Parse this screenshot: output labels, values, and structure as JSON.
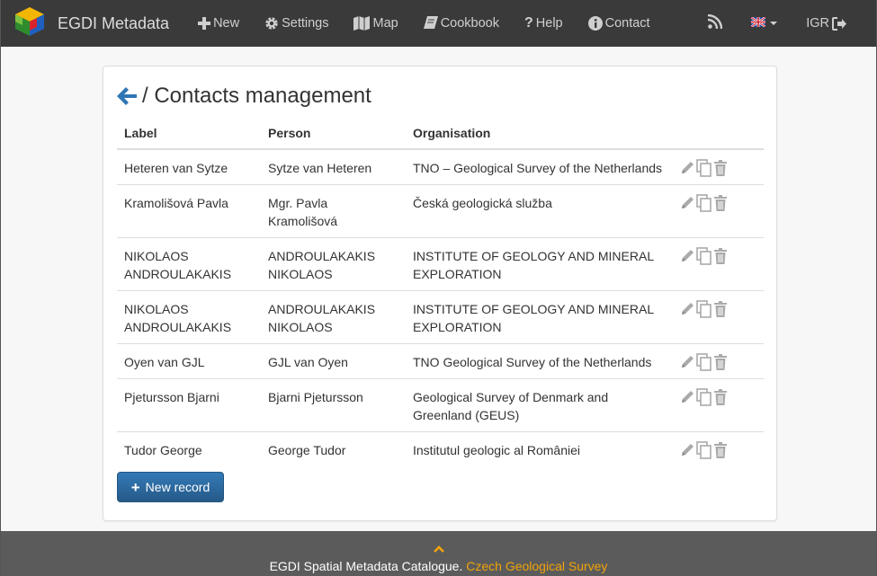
{
  "navbar": {
    "brand": "EGDI Metadata",
    "items": [
      {
        "label": "New",
        "icon": "plus-icon"
      },
      {
        "label": "Settings",
        "icon": "gear-icon"
      },
      {
        "label": "Map",
        "icon": "map-icon"
      },
      {
        "label": "Cookbook",
        "icon": "book-icon"
      },
      {
        "label": "Help",
        "icon": "question-icon"
      },
      {
        "label": "Contact",
        "icon": "info-icon"
      }
    ],
    "rss_icon": "rss-icon",
    "language_icon": "uk-flag-icon",
    "user": "IGR",
    "logout_icon": "logout-icon"
  },
  "page": {
    "title": "/ Contacts management",
    "back_icon": "arrow-left-icon"
  },
  "table": {
    "headers": [
      "Label",
      "Person",
      "Organisation"
    ],
    "rows": [
      {
        "label": "Heteren van Sytze",
        "person": "Sytze van Heteren",
        "organisation": "TNO – Geological Survey of the Netherlands"
      },
      {
        "label": "Kramolišová Pavla",
        "person": "Mgr. Pavla Kramolišová",
        "organisation": "Česká geologická služba"
      },
      {
        "label": "NIKOLAOS ANDROULAKAKIS",
        "person": "ANDROULAKAKIS NIKOLAOS",
        "organisation": "INSTITUTE OF GEOLOGY AND MINERAL EXPLORATION"
      },
      {
        "label": "NIKOLAOS ANDROULAKAKIS",
        "person": "ANDROULAKAKIS NIKOLAOS",
        "organisation": "INSTITUTE OF GEOLOGY AND MINERAL EXPLORATION"
      },
      {
        "label": "Oyen van GJL",
        "person": "GJL van Oyen",
        "organisation": "TNO Geological Survey of the Netherlands"
      },
      {
        "label": "Pjetursson Bjarni",
        "person": "Bjarni Pjetursson",
        "organisation": "Geological Survey of Denmark and Greenland (GEUS)"
      },
      {
        "label": "Tudor George",
        "person": "George Tudor",
        "organisation": "Institutul geologic al României"
      }
    ],
    "row_action_icons": [
      "pencil-icon",
      "copy-icon",
      "trash-icon"
    ]
  },
  "new_record_button": "New record",
  "footer": {
    "up_icon": "chevron-up-icon",
    "text": "EGDI Spatial Metadata Catalogue.",
    "link": "Czech Geological Survey"
  },
  "colors": {
    "navbar": "#3a3a3a",
    "footer": "#5b5b5b",
    "accent": "#337ab7",
    "footer_link": "#f0a30a"
  }
}
